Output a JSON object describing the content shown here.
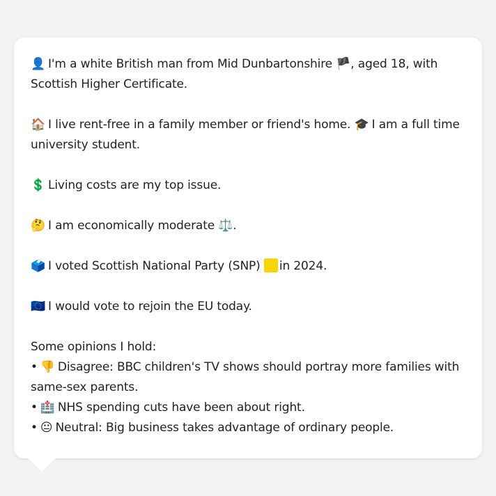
{
  "persona": {
    "intro_icon": "👤",
    "intro_before_flag": "I'm a white British man from Mid Dunbartonshire",
    "scotland_flag_icon": "🏴",
    "intro_after_flag": ", aged 18, with",
    "intro_line2": "Scottish Higher Certificate.",
    "home_icon": "🏠",
    "home_text": "I live rent-free in a family member or friend's home.",
    "grad_icon": "🎓",
    "student_text_1": "I am a full time",
    "student_text_2": "university student.",
    "money_icon": "💲",
    "issue_text": "Living costs are my top issue.",
    "thinking_icon": "🤔",
    "econ_text": "I am economically moderate",
    "scales_icon": "⚖️",
    "econ_end": ".",
    "ballot_icon": "🗳️",
    "vote_text_before": "I voted Scottish National Party (SNP)",
    "snp_color": "#f9d406",
    "vote_text_after": "in 2024.",
    "eu_icon": "🇪🇺",
    "eu_text": "I would vote to rejoin the EU today.",
    "opinions_heading": "Some opinions I hold:",
    "bullet": "•",
    "opinions": [
      {
        "icon": "👎",
        "line1": "Disagree: BBC children's TV shows should portray more families with",
        "line2": "same-sex parents."
      },
      {
        "icon": "🏥",
        "line1": "NHS spending cuts have been about right.",
        "line2": ""
      },
      {
        "icon": "😐",
        "line1": "Neutral: Big business takes advantage of ordinary people.",
        "line2": ""
      }
    ]
  }
}
